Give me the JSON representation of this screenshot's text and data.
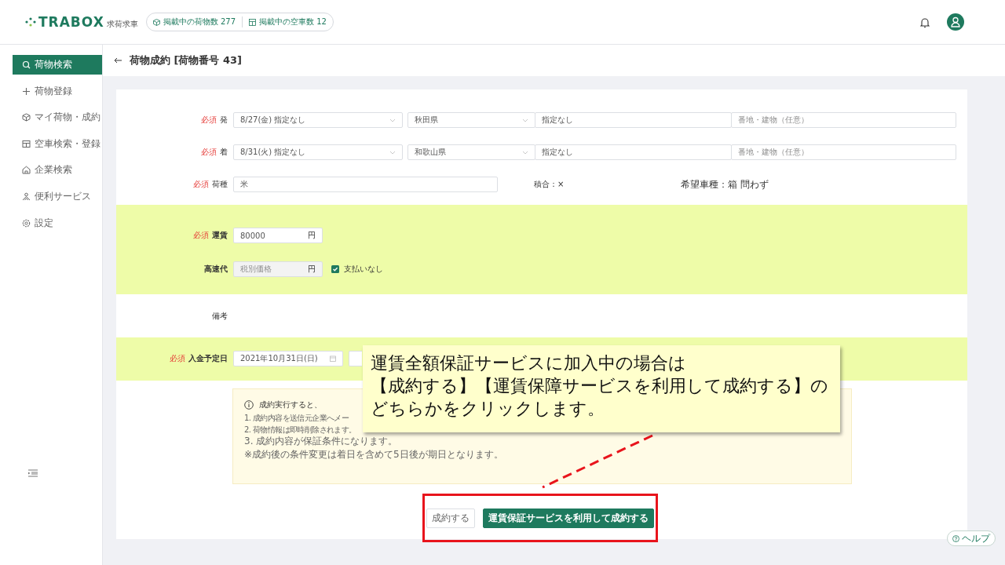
{
  "header": {
    "logo": "TRABOX",
    "logo_sub": "求荷求車",
    "stats": [
      {
        "label": "掲載中の荷物数 277"
      },
      {
        "label": "掲載中の空車数 12"
      }
    ]
  },
  "sidebar": {
    "items": [
      {
        "label": "荷物検索",
        "selected": true
      },
      {
        "label": "荷物登録",
        "selected": false
      },
      {
        "label": "マイ荷物・成約",
        "selected": false
      },
      {
        "label": "空車検索・登録",
        "selected": false
      },
      {
        "label": "企業検索",
        "selected": false
      },
      {
        "label": "便利サービス",
        "selected": false
      },
      {
        "label": "設定",
        "selected": false
      }
    ]
  },
  "page_title": "荷物成約 [荷物番号 43]",
  "form": {
    "origin": {
      "required": "必須",
      "label": "発",
      "date": "8/27(金) 指定なし",
      "prefecture": "秋田県",
      "city": "指定なし",
      "address_placeholder": "番地・建物（任意）"
    },
    "destination": {
      "required": "必須",
      "label": "着",
      "date": "8/31(火) 指定なし",
      "prefecture": "和歌山県",
      "city": "指定なし",
      "address_placeholder": "番地・建物（任意）"
    },
    "cargo": {
      "required": "必須",
      "label": "荷種",
      "value": "米",
      "mixed_load": "積合：×",
      "vehicle": "希望車種：箱 問わず"
    },
    "fare": {
      "required": "必須",
      "label": "運賃",
      "value": "80000",
      "unit": "円"
    },
    "highway": {
      "label": "高速代",
      "placeholder": "税別価格",
      "unit": "円",
      "disabled": true,
      "checkbox": {
        "label": "支払いなし",
        "checked": true
      }
    },
    "remarks": {
      "label": "備考"
    },
    "payment_date": {
      "required": "必須",
      "label": "入金予定日",
      "value": "2021年10月31日(日)"
    }
  },
  "notice": {
    "title": "成約実行すると、",
    "items": [
      "1. 成約内容を送信元企業へメー",
      "2. 荷物情報は即時削除されます。",
      "3. 成約内容が保証条件になります。"
    ],
    "note": "※成約後の条件変更は着日を含めて5日後が期日となります。"
  },
  "buttons": [
    {
      "label": "成約する",
      "kind": "secondary"
    },
    {
      "label": "運賃保証サービスを利用して成約する",
      "kind": "primary"
    }
  ],
  "help": "ヘルプ",
  "callout": {
    "lines": [
      "運賃全額保証サービスに加入中の場合は",
      "【成約する】【運賃保障サービスを利用して成約する】の",
      "どちらかをクリックします。"
    ]
  }
}
